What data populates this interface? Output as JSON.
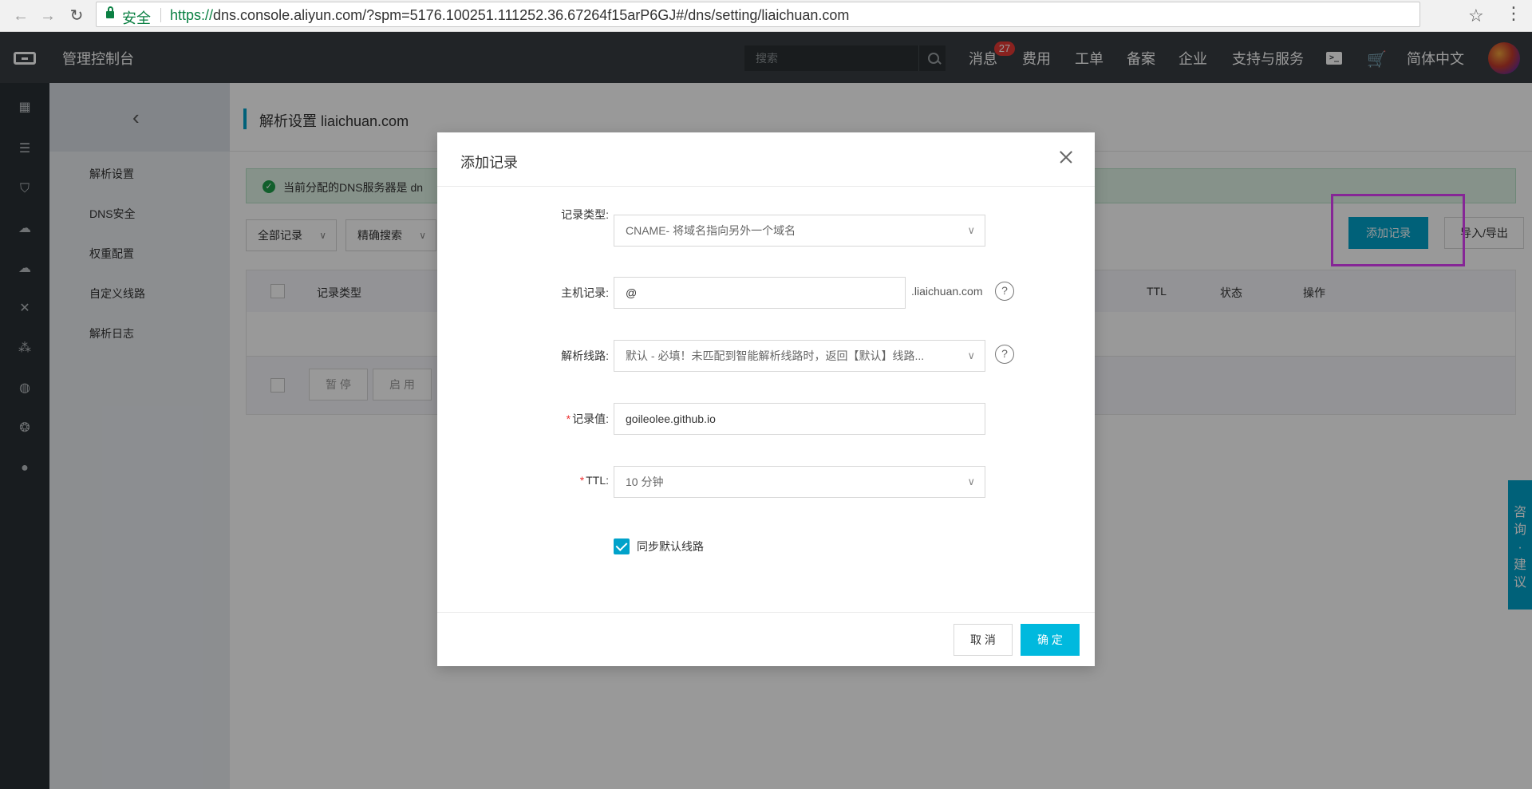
{
  "browser": {
    "secure_label": "安全",
    "url_scheme": "https://",
    "url_rest": "dns.console.aliyun.com/?spm=5176.100251.111252.36.67264f15arP6GJ#/dns/setting/liaichuan.com"
  },
  "topbar": {
    "title": "管理控制台",
    "search_placeholder": "搜索",
    "messages_label": "消息",
    "messages_count": "27",
    "fees_label": "费用",
    "tickets_label": "工单",
    "beian_label": "备案",
    "enterprise_label": "企业",
    "support_label": "支持与服务",
    "language_label": "简体中文"
  },
  "sidebar": {
    "items": [
      {
        "label": "解析设置"
      },
      {
        "label": "DNS安全"
      },
      {
        "label": "权重配置"
      },
      {
        "label": "自定义线路"
      },
      {
        "label": "解析日志"
      }
    ]
  },
  "main": {
    "title": "解析设置 liaichuan.com",
    "notice": "当前分配的DNS服务器是",
    "notice_tail": "dn",
    "filter_all": "全部记录",
    "filter_mode": "精确搜索",
    "add_record": "添加记录",
    "import_export": "导入/导出",
    "table_headers": {
      "type": "记录类型",
      "ttl": "TTL",
      "status": "状态",
      "action": "操作"
    },
    "pause_btn": "暂 停",
    "enable_btn": "启 用"
  },
  "side_float": {
    "text": [
      "咨",
      "询",
      "·",
      "建",
      "议"
    ]
  },
  "dialog": {
    "title": "添加记录",
    "record_type_label": "记录类型:",
    "record_type_value": "CNAME- 将域名指向另外一个域名",
    "host_label": "主机记录:",
    "host_value": "@",
    "host_suffix": ".liaichuan.com",
    "line_label": "解析线路:",
    "line_value": "默认 - 必填！未匹配到智能解析线路时，返回【默认】线路...",
    "value_label": "记录值:",
    "value_value": "goileolee.github.io",
    "ttl_label": "TTL:",
    "ttl_value": "10 分钟",
    "sync_label": "同步默认线路",
    "cancel_label": "取 消",
    "ok_label": "确 定"
  },
  "colors": {
    "accent": "#00a2ca",
    "topbar": "#373d41",
    "highlight": "#e040fb"
  }
}
